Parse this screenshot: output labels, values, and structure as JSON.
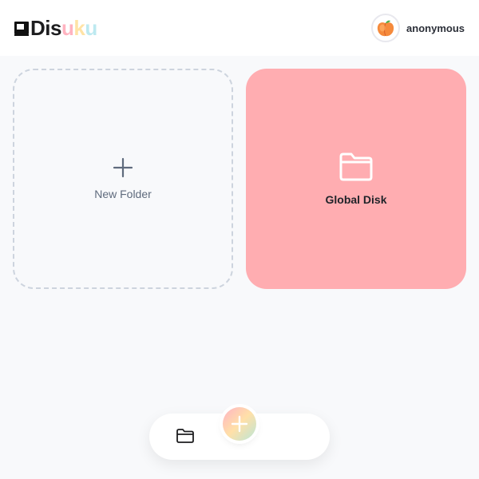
{
  "header": {
    "logo": {
      "p1": "Dis",
      "p2": "u",
      "p3": "k",
      "p4": "u"
    },
    "user": {
      "avatar_icon": "peach-icon",
      "name": "anonymous"
    }
  },
  "cards": [
    {
      "id": "new-folder",
      "icon": "plus-icon",
      "label": "New Folder"
    },
    {
      "id": "global-disk",
      "icon": "folder-icon",
      "label": "Global Disk",
      "color": "#ffadb1"
    }
  ],
  "dock": {
    "left_icon": "folder-icon",
    "fab_icon": "plus-icon",
    "fab_colors": [
      "#ffb3c4",
      "#ffe0a8",
      "#b9e6d8"
    ]
  }
}
